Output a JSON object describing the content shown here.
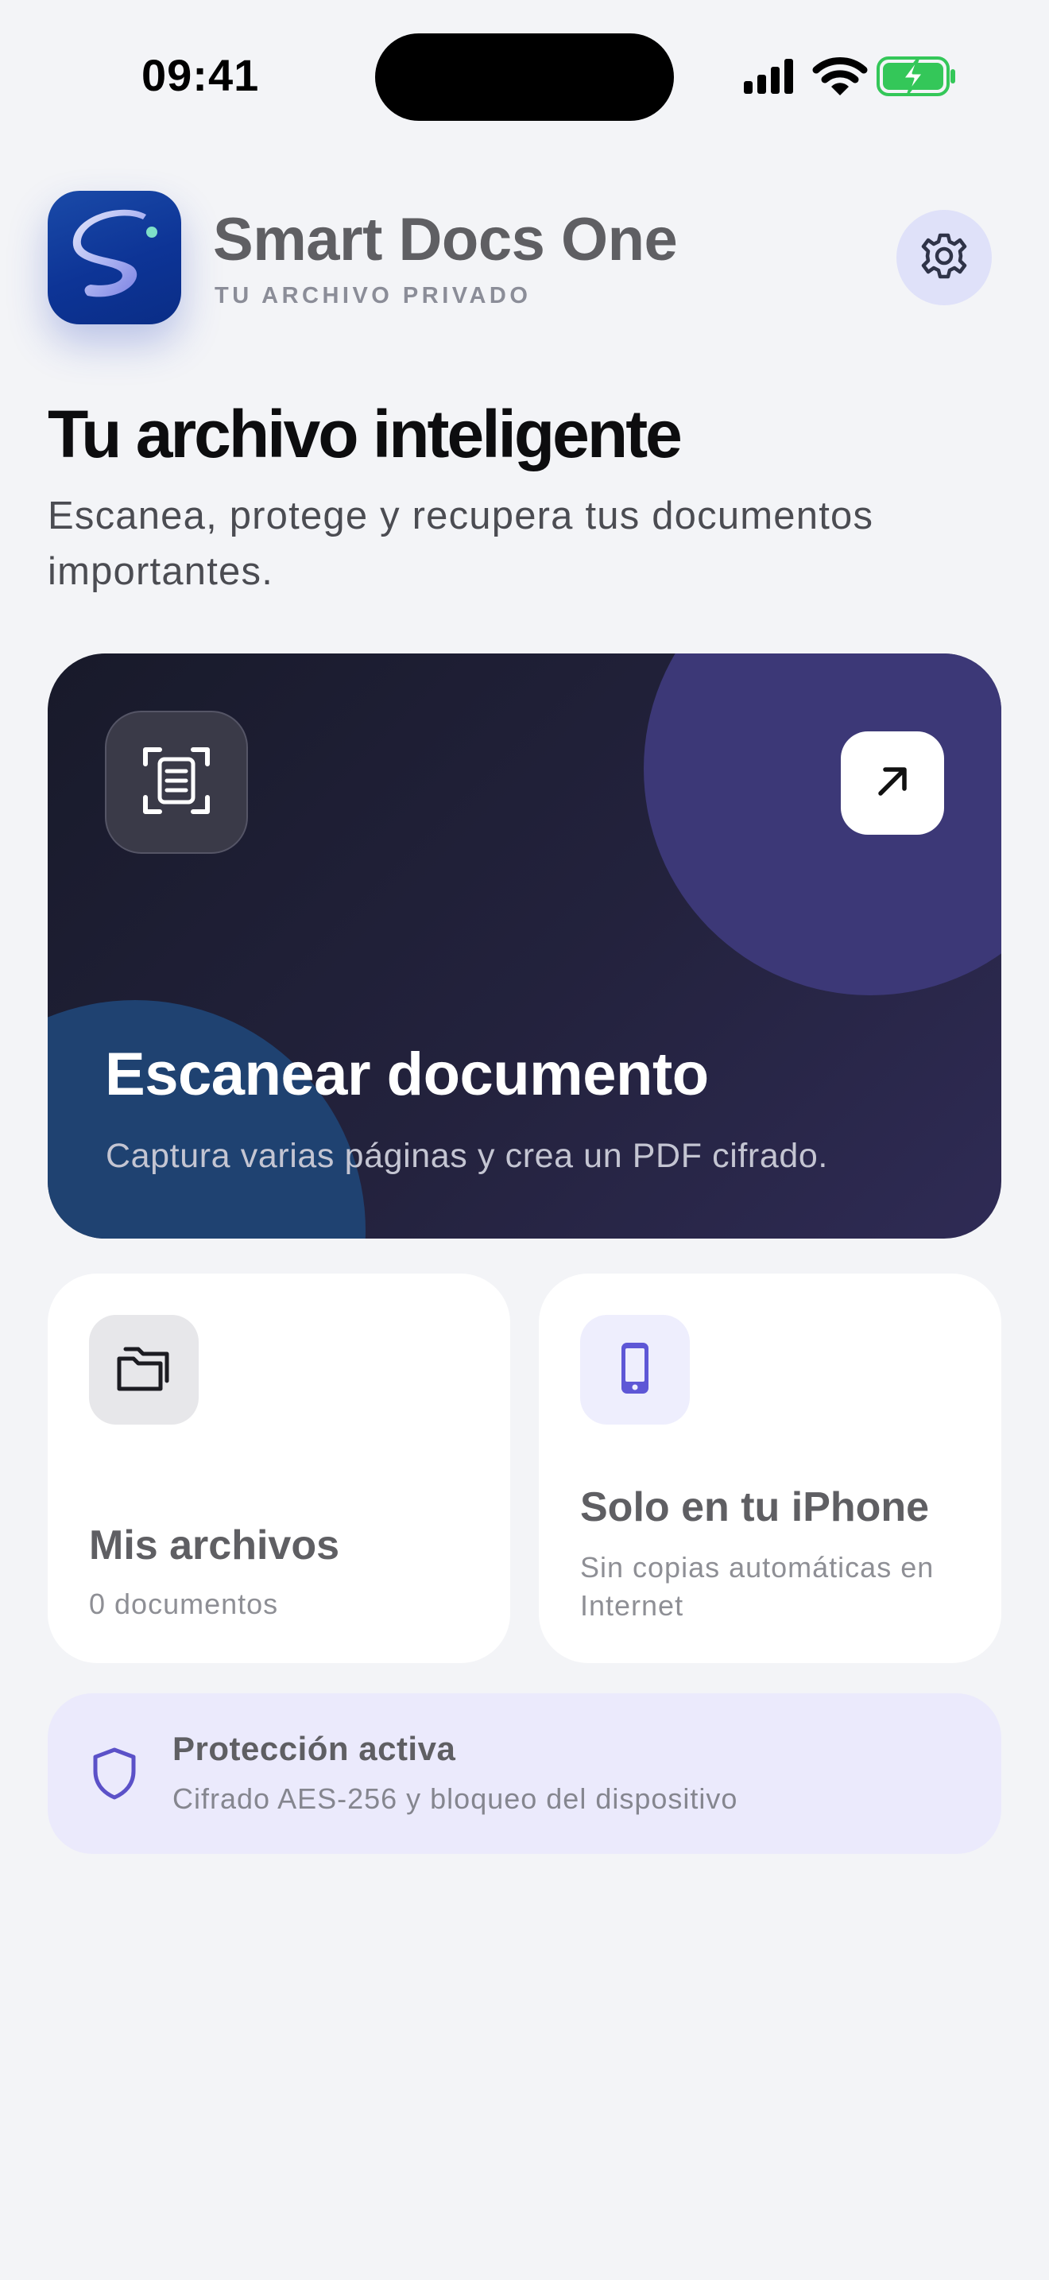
{
  "status_bar": {
    "time": "09:41",
    "icons": [
      "cellular-signal-icon",
      "wifi-icon",
      "battery-charging-icon"
    ]
  },
  "header": {
    "app_name": "Smart Docs One",
    "app_subtitle": "TU ARCHIVO PRIVADO",
    "settings_icon": "gear-icon"
  },
  "hero": {
    "title": "Tu archivo inteligente",
    "subtitle": "Escanea, protege y recupera tus documentos importantes."
  },
  "scan_card": {
    "icon": "document-scan-icon",
    "action_icon": "arrow-up-right-icon",
    "title": "Escanear documento",
    "description": "Captura varias páginas y crea un PDF cifrado."
  },
  "files_card": {
    "icon": "folder-icon",
    "title": "Mis archivos",
    "count": "0 documentos"
  },
  "iphone_card": {
    "icon": "iphone-icon",
    "title": "Solo en tu iPhone",
    "description": "Sin copias automáticas en Internet"
  },
  "protection": {
    "icon": "shield-icon",
    "title": "Protección activa",
    "description": "Cifrado AES-256 y bloqueo del dispositivo"
  },
  "colors": {
    "background": "#f3f4f7",
    "accent": "#5b51c8",
    "app_icon_blue": "#0d3496",
    "battery_green": "#34c759",
    "card_dark": "#23223d"
  }
}
